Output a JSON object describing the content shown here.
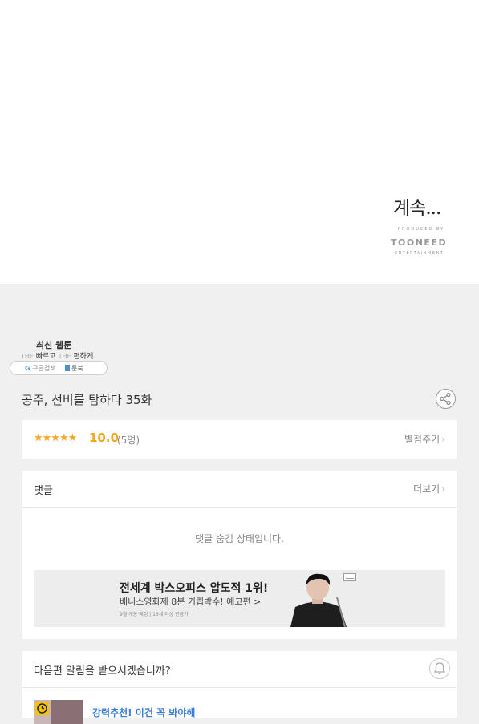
{
  "end_panel": {
    "to_be_continued": "계속...",
    "produced_by": "PRODUCED BY",
    "studio": "TOONEED",
    "studio_sub": "ENTERTAINMENT"
  },
  "promo_badge": {
    "title": "최신 웹툰",
    "the1": "THE",
    "faster": "빠르고",
    "the2": "THE",
    "easier": "편하게",
    "google_g": "G",
    "google_label": "구글검색",
    "site": "툰북"
  },
  "episode": {
    "title": "공주, 선비를 탐하다 35화"
  },
  "rating": {
    "stars": "★★★★★",
    "score": "10.0",
    "votes": "(5명)",
    "rate_link": "별점주기"
  },
  "comments": {
    "label": "댓글",
    "more": "더보기",
    "hidden_msg": "댓글 숨김 상태입니다."
  },
  "ad": {
    "headline": "전세계 박스오피스 압도적 1위!",
    "subline": "베니스영화제 8분 기립박수! 예고편 >",
    "fine_print": "9월 개봉 예정  |  15세 이상 관람가"
  },
  "notify": {
    "question": "다음편 알림을 받으시겠습니까?",
    "recommend": "강력추천! 이건 꼭 봐야해"
  },
  "colors": {
    "accent_star": "#f5a623",
    "link_blue": "#3b7dd8",
    "page_bg": "#f0f0f0"
  }
}
